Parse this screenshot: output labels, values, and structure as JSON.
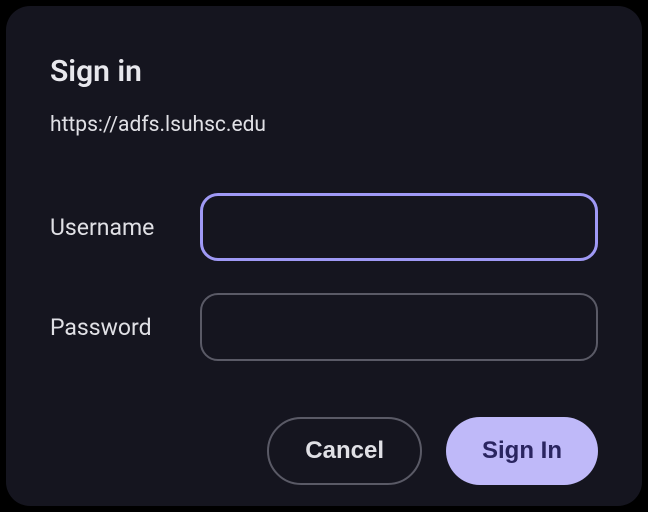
{
  "dialog": {
    "title": "Sign in",
    "url": "https://adfs.lsuhsc.edu",
    "username_label": "Username",
    "username_value": "",
    "password_label": "Password",
    "password_value": "",
    "cancel_label": "Cancel",
    "signin_label": "Sign In"
  }
}
